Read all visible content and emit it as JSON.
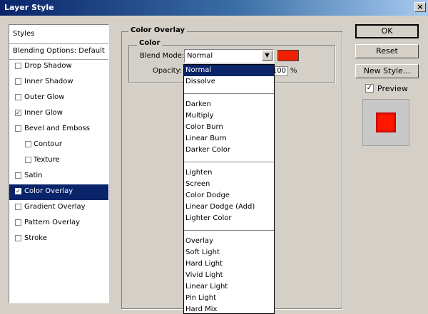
{
  "window": {
    "title": "Layer Style",
    "close_glyph": "×"
  },
  "left_panel": {
    "header": "Styles",
    "blending": "Blending Options: Default",
    "items": [
      {
        "label": "Drop Shadow",
        "checked": false
      },
      {
        "label": "Inner Shadow",
        "checked": false
      },
      {
        "label": "Outer Glow",
        "checked": false
      },
      {
        "label": "Inner Glow",
        "checked": true
      },
      {
        "label": "Bevel and Emboss",
        "checked": false
      },
      {
        "label": "Contour",
        "checked": false,
        "indent": true
      },
      {
        "label": "Texture",
        "checked": false,
        "indent": true
      },
      {
        "label": "Satin",
        "checked": false
      },
      {
        "label": "Color Overlay",
        "checked": true,
        "selected": true
      },
      {
        "label": "Gradient Overlay",
        "checked": false
      },
      {
        "label": "Pattern Overlay",
        "checked": false
      },
      {
        "label": "Stroke",
        "checked": false
      }
    ]
  },
  "buttons": {
    "ok": "OK",
    "reset": "Reset",
    "new_style": "New Style..."
  },
  "preview": {
    "label": "Preview",
    "checked": true
  },
  "color_overlay": {
    "group_title": "Color Overlay",
    "sub_title": "Color",
    "blend_label": "Blend Mode:",
    "blend_value": "Normal",
    "opacity_label": "Opacity:",
    "opacity_value": "100",
    "opacity_unit": "%",
    "overlay_color": "#f02000"
  },
  "dropdown": {
    "groups": [
      [
        "Normal",
        "Dissolve"
      ],
      [
        "Darken",
        "Multiply",
        "Color Burn",
        "Linear Burn",
        "Darker Color"
      ],
      [
        "Lighten",
        "Screen",
        "Color Dodge",
        "Linear Dodge (Add)",
        "Lighter Color"
      ],
      [
        "Overlay",
        "Soft Light",
        "Hard Light",
        "Vivid Light",
        "Linear Light",
        "Pin Light",
        "Hard Mix"
      ]
    ],
    "selected": "Normal"
  },
  "colors": {
    "selection": "#0a246a",
    "face": "#d4d0c8"
  }
}
